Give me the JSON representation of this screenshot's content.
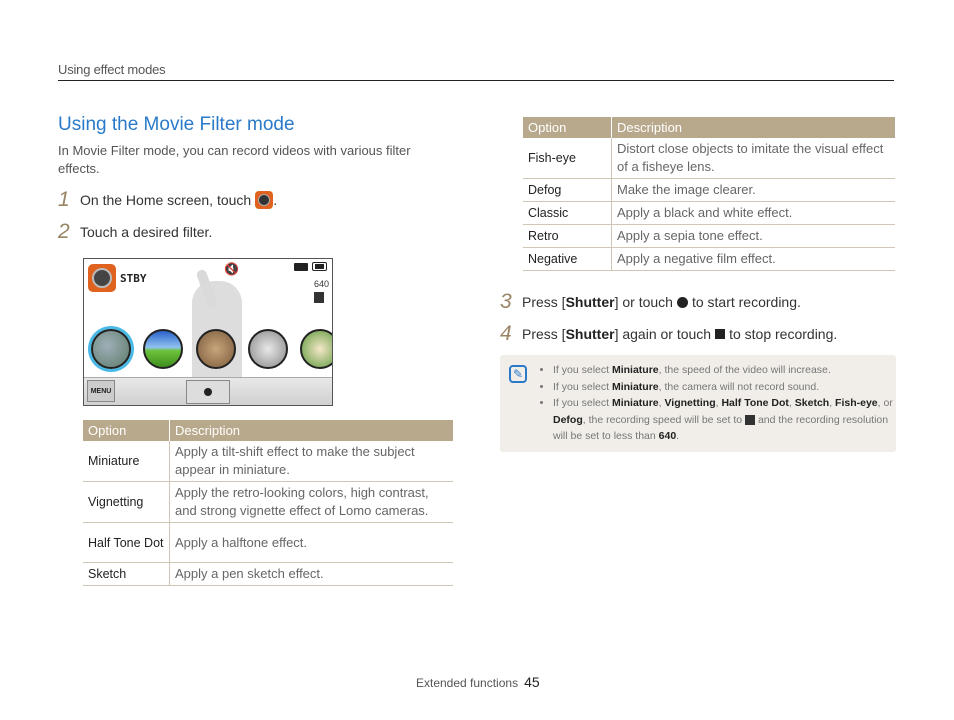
{
  "header": {
    "section": "Using effect modes"
  },
  "main": {
    "title": "Using the Movie Filter mode",
    "intro": "In Movie Filter mode, you can record videos with various filter effects.",
    "steps": [
      {
        "num": "1",
        "text": "On the Home screen, touch",
        "suffix": ".",
        "icon": "movie-filter-mode-icon"
      },
      {
        "num": "2",
        "text": "Touch a desired filter."
      },
      {
        "num": "3",
        "pre": "Press [",
        "key": "Shutter",
        "post": "] or touch",
        "icon": "record-circle-icon",
        "end": "to start recording."
      },
      {
        "num": "4",
        "pre": "Press [",
        "key": "Shutter",
        "post": "] again or touch",
        "icon": "stop-square-icon",
        "end": "to stop recording."
      }
    ]
  },
  "camera_screen": {
    "status": "STBY",
    "resolution": "640",
    "menu_label": "MENU",
    "filters": [
      "Miniature",
      "Vignetting",
      "Half Tone Dot",
      "Sketch",
      "Fish-eye"
    ],
    "selected_filter_index": 0,
    "colors": {
      "selection_ring": "#49b9e6",
      "mode_icon": "#e0621f"
    }
  },
  "table_left": {
    "headers": [
      "Option",
      "Description"
    ],
    "rows": [
      {
        "option": "Miniature",
        "description": "Apply a tilt-shift effect to make the subject appear in miniature."
      },
      {
        "option": "Vignetting",
        "description": "Apply the retro-looking colors, high contrast, and strong vignette effect of Lomo cameras."
      },
      {
        "option": "Half Tone Dot",
        "description": "Apply a halftone effect."
      },
      {
        "option": "Sketch",
        "description": "Apply a pen sketch effect."
      }
    ]
  },
  "table_right": {
    "headers": [
      "Option",
      "Description"
    ],
    "rows": [
      {
        "option": "Fish-eye",
        "description": "Distort close objects to imitate the visual effect of a fisheye lens."
      },
      {
        "option": "Defog",
        "description": "Make the image clearer."
      },
      {
        "option": "Classic",
        "description": "Apply a black and white effect."
      },
      {
        "option": "Retro",
        "description": "Apply a sepia tone effect."
      },
      {
        "option": "Negative",
        "description": "Apply a negative film effect."
      }
    ]
  },
  "note": {
    "b1": {
      "pre": "If you select ",
      "bold": "Miniature",
      "post": ", the speed of the video will increase."
    },
    "b2": {
      "pre": "If you select ",
      "bold": "Miniature",
      "post": ", the camera will not record sound."
    },
    "b3": {
      "pre": "If you select ",
      "b_a": "Miniature",
      "b_b": "Vignetting",
      "b_c": "Half Tone Dot",
      "b_d": "Sketch",
      "b_e": "Fish-eye",
      "or": ", or ",
      "b_f": "Defog",
      "mid": ", the recording speed will be set to",
      "mid2": "and the recording resolution will be set to less than ",
      "res": "640",
      "end": "."
    }
  },
  "footer": {
    "label": "Extended functions",
    "page": "45"
  },
  "colors": {
    "title": "#2a7ac9",
    "table_header": "#b9a98c",
    "step_number": "#9a8466",
    "note_bg": "#f1eee9"
  }
}
